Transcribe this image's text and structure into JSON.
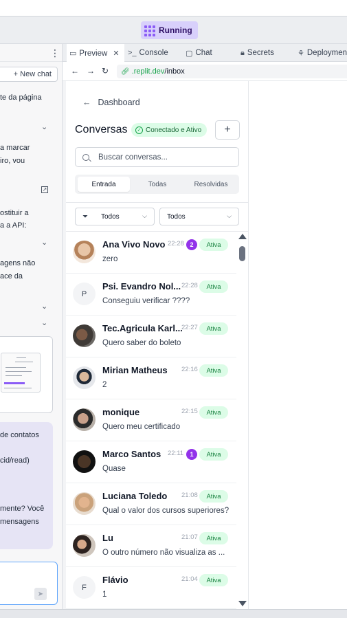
{
  "topbar": {
    "status_label": "Running"
  },
  "left_panel": {
    "new_chat_label": "+ New chat",
    "snippets": [
      "te da página",
      "a marcar",
      "iro, vou",
      "ostituir a",
      "a a API:",
      "agens não",
      "ace da",
      "de contatos",
      "cid/read)",
      "mente? Você",
      "mensagens"
    ]
  },
  "tabs": [
    {
      "icon": "monitor-icon",
      "label": "Preview",
      "active": true
    },
    {
      "icon": "terminal-icon",
      "label": "Console"
    },
    {
      "icon": "chat-bubble-icon",
      "label": "Chat"
    },
    {
      "icon": "lock-icon",
      "label": "Secrets"
    },
    {
      "icon": "deploy-icon",
      "label": "Deploymen"
    }
  ],
  "address": {
    "domain": ".replit.dev",
    "path": "/inbox"
  },
  "inbox": {
    "back_label": "Dashboard",
    "title": "Conversas",
    "status_badge": "Conectado e Ativo",
    "search_placeholder": "Buscar conversas...",
    "segments": [
      "Entrada",
      "Todas",
      "Resolvidas"
    ],
    "filter1": "Todos",
    "filter2": "Todos",
    "conversations": [
      {
        "name": "Ana Vivo Novo",
        "time": "22:28",
        "unread": "2",
        "status": "Ativa",
        "preview": "zero"
      },
      {
        "name": "Psi. Evandro Nol...",
        "time": "22:28",
        "unread": "",
        "status": "Ativa",
        "preview": "Conseguiu verificar ????",
        "initial": "P"
      },
      {
        "name": "Tec.Agricula Karl...",
        "time": "22:27",
        "unread": "",
        "status": "Ativa",
        "preview": "Quero saber do boleto"
      },
      {
        "name": "Mirian Matheus",
        "time": "22:16",
        "unread": "",
        "status": "Ativa",
        "preview": "2"
      },
      {
        "name": "monique",
        "time": "22:15",
        "unread": "",
        "status": "Ativa",
        "preview": "Quero meu certificado"
      },
      {
        "name": "Marco Santos",
        "time": "22:11",
        "unread": "1",
        "status": "Ativa",
        "preview": "Quase"
      },
      {
        "name": "Luciana Toledo",
        "time": "21:08",
        "unread": "",
        "status": "Ativa",
        "preview": "Qual o valor dos cursos superiores?"
      },
      {
        "name": "Lu",
        "time": "21:07",
        "unread": "",
        "status": "Ativa",
        "preview": "O outro número não visualiza as ..."
      },
      {
        "name": "Flávio",
        "time": "21:04",
        "unread": "",
        "status": "Ativa",
        "preview": "1",
        "initial": "F"
      }
    ]
  }
}
